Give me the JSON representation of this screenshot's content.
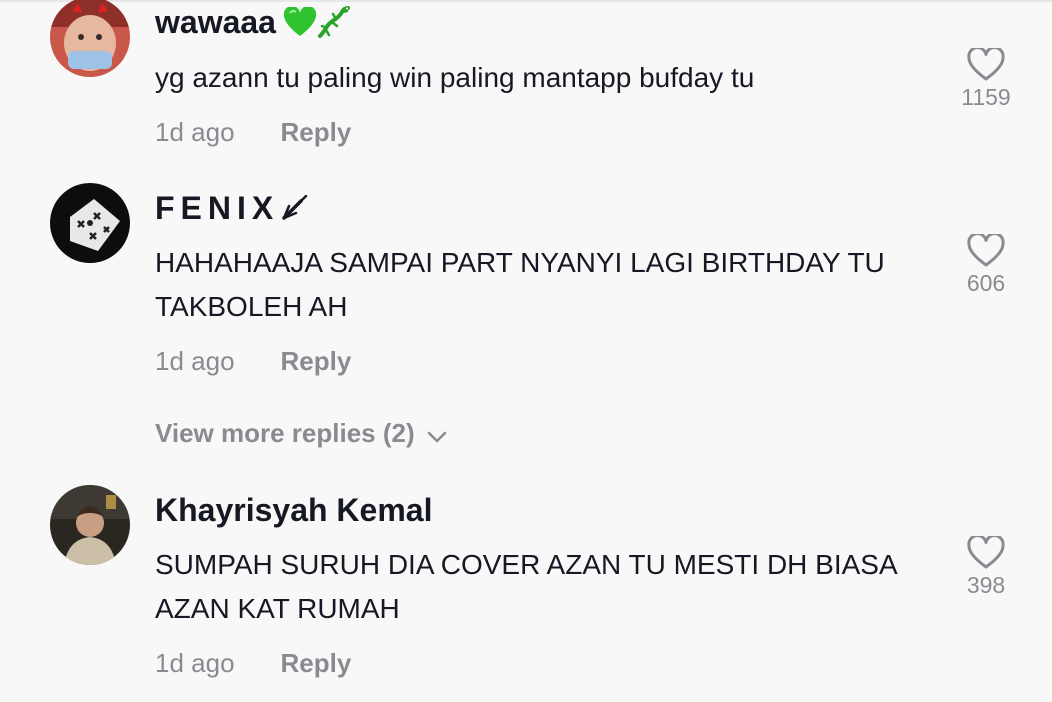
{
  "comments": [
    {
      "username": "wawaaa",
      "text": "yg azann tu paling win paling mantapp bufday tu",
      "time": "1d ago",
      "reply_label": "Reply",
      "likes": "1159"
    },
    {
      "username": "FENIX",
      "text": "HAHAHAAJA SAMPAI PART NYANYI LAGI BIRTHDAY TU TAKBOLEH AH",
      "time": "1d ago",
      "reply_label": "Reply",
      "likes": "606",
      "view_more": "View more replies (2)"
    },
    {
      "username": "Khayrisyah Kemal",
      "text": "SUMPAH SURUH DIA COVER AZAN TU MESTI DH BIASA AZAN KAT RUMAH",
      "time": "1d ago",
      "reply_label": "Reply",
      "likes": "398"
    }
  ],
  "colors": {
    "background": "#f8f8f8",
    "primary_text": "#161823",
    "secondary_text": "#8a8b91"
  },
  "icons": [
    "heart-outline-icon",
    "chevron-down-icon",
    "green-heart-emoji",
    "lizard-emoji",
    "pen-icon"
  ]
}
